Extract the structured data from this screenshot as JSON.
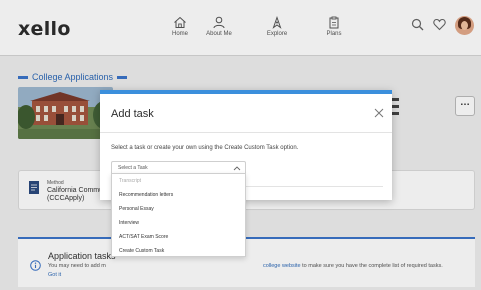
{
  "app": {
    "logo": "xello"
  },
  "nav": [
    {
      "label": "Home",
      "icon": "home-icon"
    },
    {
      "label": "About Me",
      "icon": "person-icon"
    },
    {
      "label": "Explore",
      "icon": "compass-icon"
    },
    {
      "label": "Plans",
      "icon": "clipboard-icon"
    }
  ],
  "header_icons": [
    "search-icon",
    "heart-icon",
    "avatar"
  ],
  "breadcrumb": {
    "label": "College Applications"
  },
  "method": {
    "label": "Method",
    "value_line1": "California Commun",
    "value_line2": "(CCCApply)"
  },
  "tasks_card": {
    "title": "Application tasks",
    "desc": "You may need to add m",
    "link": "Got it",
    "desc2_link": "college website",
    "desc2_rest": " to make sure you have the complete list of required tasks."
  },
  "modal": {
    "title": "Add task",
    "help": "Select a task or create your own using the Create Custom Task option.",
    "select_placeholder": "Select a Task",
    "options": [
      {
        "label": "Transcript",
        "disabled": true
      },
      {
        "label": "Recommendation letters",
        "disabled": false
      },
      {
        "label": "Personal Essay",
        "disabled": false
      },
      {
        "label": "Interview",
        "disabled": false
      },
      {
        "label": "ACT/SAT Exam Score",
        "disabled": false
      },
      {
        "label": "Create Custom Task",
        "disabled": false
      }
    ]
  },
  "colors": {
    "accent": "#3b8fdc",
    "link": "#2e6ab8",
    "background": "#eeeeee"
  }
}
